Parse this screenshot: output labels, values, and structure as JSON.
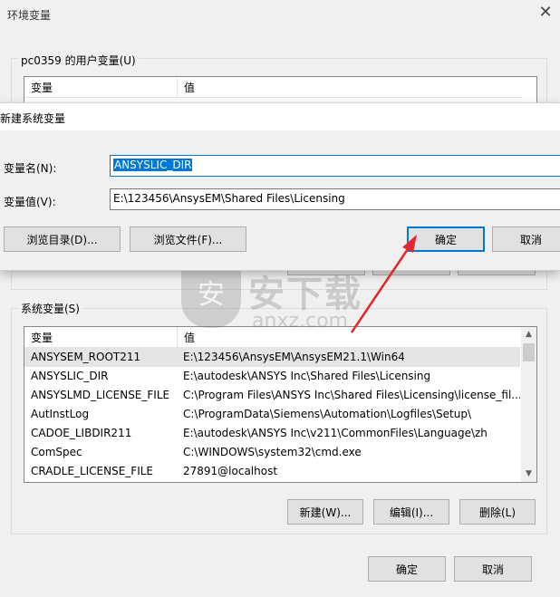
{
  "outer": {
    "title": "环境变量",
    "user_group_label": "pc0359 的用户变量(U)",
    "user_columns": [
      "变量",
      "值"
    ],
    "system_group_label": "系统变量(S)",
    "system_columns": [
      "变量",
      "值"
    ],
    "system_rows": [
      {
        "name": "ANSYSEM_ROOT211",
        "value": "E:\\123456\\AnsysEM\\AnsysEM21.1\\Win64"
      },
      {
        "name": "ANSYSLIC_DIR",
        "value": "E:\\autodesk\\ANSYS Inc\\Shared Files\\Licensing"
      },
      {
        "name": "ANSYSLMD_LICENSE_FILE",
        "value": "C:\\Program Files\\ANSYS Inc\\Shared Files\\Licensing\\license_fil..."
      },
      {
        "name": "AutInstLog",
        "value": "C:\\ProgramData\\Siemens\\Automation\\Logfiles\\Setup\\"
      },
      {
        "name": "CADOE_LIBDIR211",
        "value": "E:\\autodesk\\ANSYS Inc\\v211\\CommonFiles\\Language\\zh"
      },
      {
        "name": "ComSpec",
        "value": "C:\\WINDOWS\\system32\\cmd.exe"
      },
      {
        "name": "CRADLE_LICENSE_FILE",
        "value": "27891@localhost"
      }
    ],
    "sys_new": "新建(W)...",
    "sys_edit": "编辑(I)...",
    "sys_delete": "删除(L)",
    "ok": "确定",
    "cancel": "取消"
  },
  "dialog": {
    "title": "新建系统变量",
    "name_label": "变量名(N):",
    "name_value": "ANSYSLIC_DIR",
    "value_label": "变量值(V):",
    "value_value": "E:\\123456\\AnsysEM\\Shared Files\\Licensing",
    "browse_dir": "浏览目录(D)...",
    "browse_file": "浏览文件(F)...",
    "ok": "确定",
    "cancel": "取消"
  },
  "watermark": {
    "text": "安下载",
    "sub": "anxz.com"
  },
  "colors": {
    "accent": "#0078d7",
    "arrow": "#e0282e"
  }
}
